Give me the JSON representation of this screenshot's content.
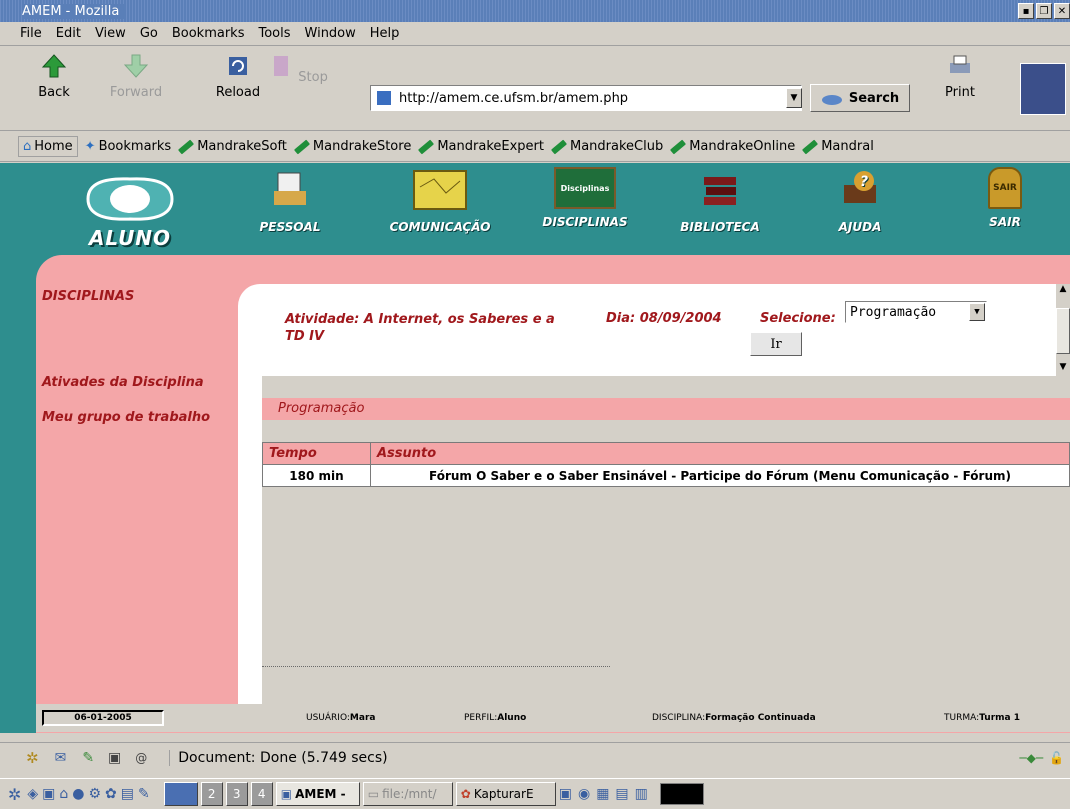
{
  "window": {
    "title": "AMEM - Mozilla"
  },
  "menubar": [
    "File",
    "Edit",
    "View",
    "Go",
    "Bookmarks",
    "Tools",
    "Window",
    "Help"
  ],
  "navbar": {
    "back": "Back",
    "forward": "Forward",
    "reload": "Reload",
    "stop": "Stop",
    "url": "http://amem.ce.ufsm.br/amem.php",
    "search": "Search",
    "print": "Print"
  },
  "bookmarks": [
    "Home",
    "Bookmarks",
    "MandrakeSoft",
    "MandrakeStore",
    "MandrakeExpert",
    "MandrakeClub",
    "MandrakeOnline",
    "Mandral"
  ],
  "site": {
    "logo": "ALUNO",
    "nav": [
      "PESSOAL",
      "COMUNICAÇÃO",
      "DISCIPLINAS",
      "BIBLIOTECA",
      "AJUDA",
      "SAIR"
    ],
    "disciplinas_icon_label": "Disciplinas",
    "sair_icon_label": "SAIR"
  },
  "sidebar": {
    "title": "DISCIPLINAS",
    "items": [
      "Ativades da Disciplina",
      "Meu grupo de trabalho"
    ]
  },
  "main": {
    "atividade": "Atividade: A Internet, os Saberes e a TD IV",
    "dia": "Dia: 08/09/2004",
    "selecione": "Selecione:",
    "select_value": "Programação",
    "ir": "Ir",
    "section": "Programação",
    "table": {
      "headers": [
        "Tempo",
        "Assunto"
      ],
      "rows": [
        [
          "180 min",
          "Fórum O Saber e o Saber Ensinável - Participe do Fórum (Menu Comunicação - Fórum)"
        ]
      ]
    }
  },
  "footer": {
    "date": "06-01-2005",
    "usuario_label": "USUÁRIO:",
    "usuario": "Mara",
    "perfil_label": "PERFIL:",
    "perfil": "Aluno",
    "disciplina_label": "DISCIPLINA:",
    "disciplina": "Formação Continuada",
    "turma_label": "TURMA:",
    "turma": "Turma 1"
  },
  "status": {
    "text": "Document: Done (5.749 secs)"
  },
  "taskbar": {
    "desktops": [
      "2",
      "3",
      "4"
    ],
    "tasks": [
      "AMEM -",
      "file:/mnt/",
      "KapturarE"
    ]
  }
}
